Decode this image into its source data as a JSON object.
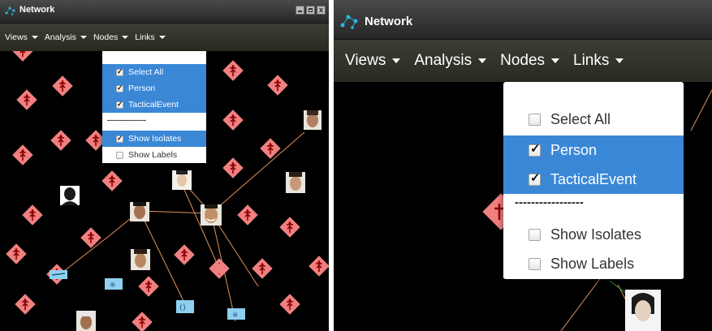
{
  "left_window": {
    "title": "Network",
    "window_buttons": [
      "minimize-icon",
      "maximize-icon",
      "close-icon"
    ],
    "close_glyph": "x",
    "menus": [
      {
        "label": "Views"
      },
      {
        "label": "Analysis"
      },
      {
        "label": "Nodes"
      },
      {
        "label": "Links"
      }
    ],
    "nodes_dropdown": {
      "items": [
        {
          "label": "Select All",
          "checked": true,
          "highlighted": true
        },
        {
          "label": "Person",
          "checked": true,
          "highlighted": true
        },
        {
          "label": "TacticalEvent",
          "checked": true,
          "highlighted": true
        }
      ],
      "divider": "----------------",
      "options": [
        {
          "label": "Show Isolates",
          "checked": true,
          "highlighted": true
        },
        {
          "label": "Show Labels",
          "checked": false,
          "highlighted": false
        }
      ]
    }
  },
  "right_window": {
    "title": "Network",
    "menus": [
      {
        "label": "Views"
      },
      {
        "label": "Analysis"
      },
      {
        "label": "Nodes"
      },
      {
        "label": "Links"
      }
    ],
    "nodes_dropdown": {
      "items": [
        {
          "label": "Select All",
          "checked": false,
          "highlighted": false
        },
        {
          "label": "Person",
          "checked": true,
          "highlighted": true
        },
        {
          "label": "TacticalEvent",
          "checked": true,
          "highlighted": true
        }
      ],
      "divider": "-----------------",
      "options": [
        {
          "label": "Show Isolates",
          "checked": false,
          "highlighted": false
        },
        {
          "label": "Show Labels",
          "checked": false,
          "highlighted": false
        }
      ]
    }
  },
  "colors": {
    "canvas": "#000000",
    "event_node": "#f08080",
    "event_glyph": "#8b0000",
    "link": "#e0905a",
    "link_alt": "#3a9a3a",
    "selected_item": "#3a87d6",
    "blue_node": "#8fd0f0"
  },
  "icons": [
    "network-icon",
    "tactical-event-icon",
    "person-photo",
    "weapon-icon",
    "caret-down-icon",
    "checkbox-icon"
  ]
}
